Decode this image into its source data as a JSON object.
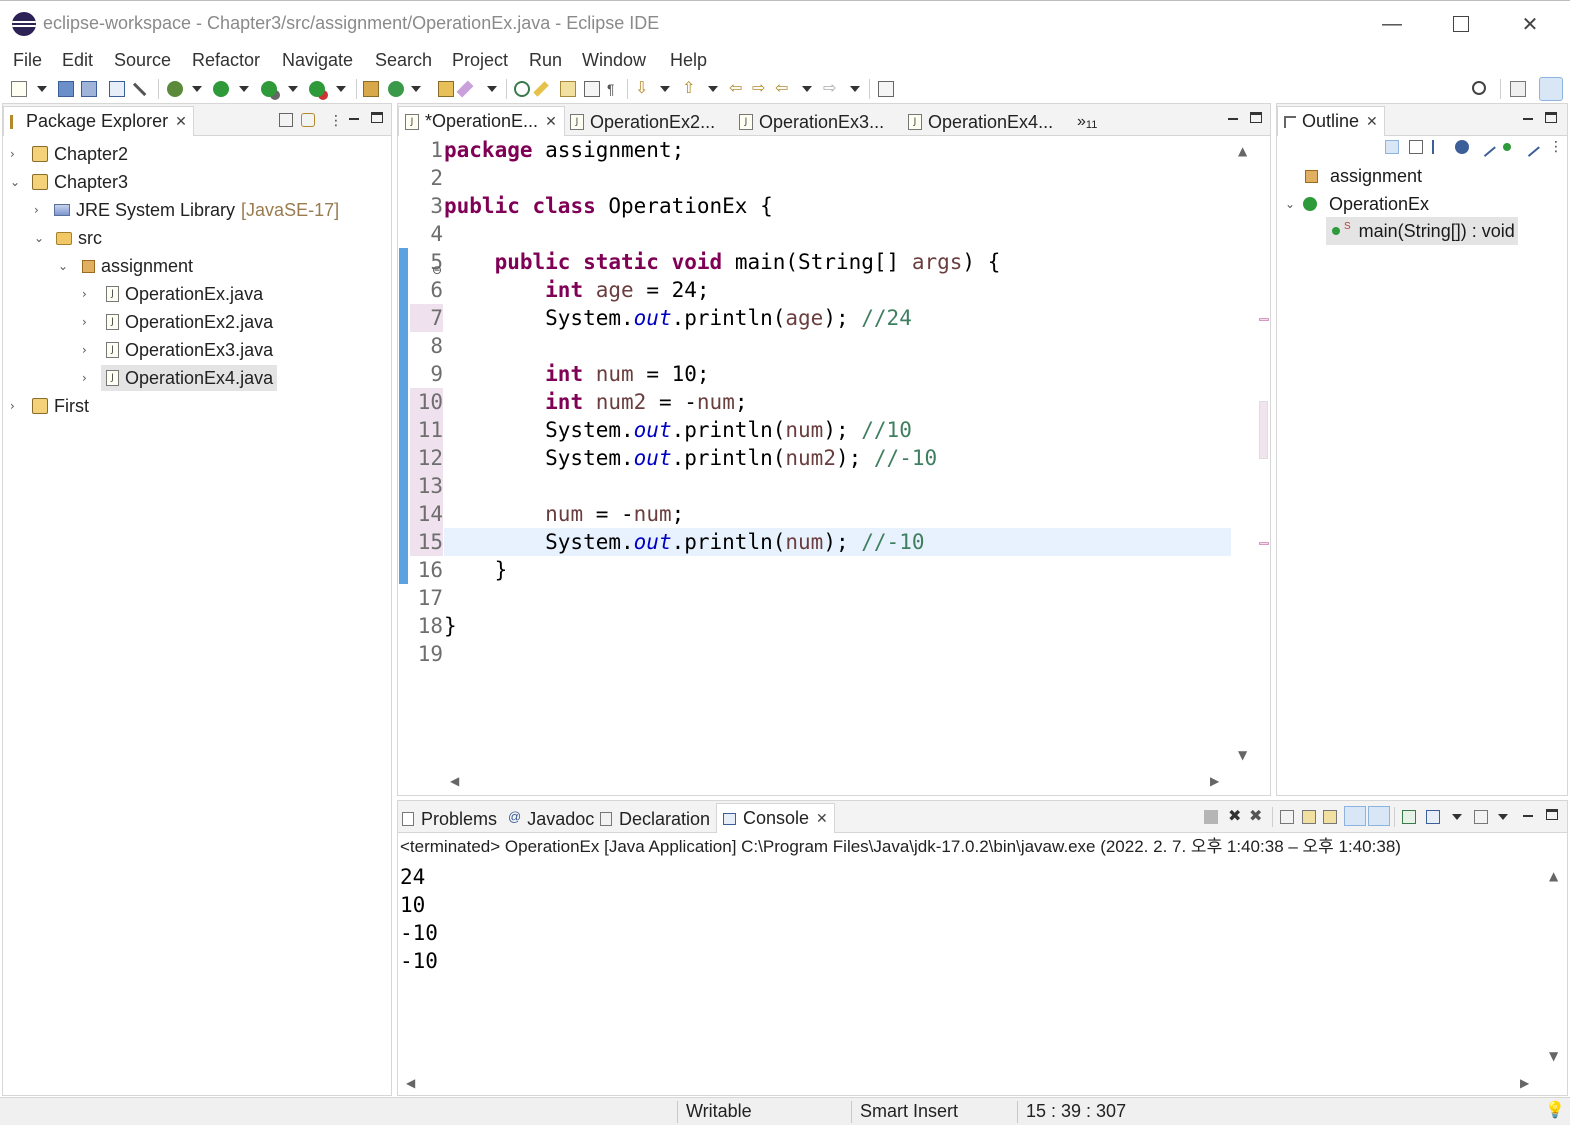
{
  "window": {
    "title": "eclipse-workspace - Chapter3/src/assignment/OperationEx.java - Eclipse IDE",
    "minimize": "—",
    "close": "✕"
  },
  "menubar": [
    "File",
    "Edit",
    "Source",
    "Refactor",
    "Navigate",
    "Search",
    "Project",
    "Run",
    "Window",
    "Help"
  ],
  "package_explorer": {
    "tab_label": "Package Explorer",
    "tree": [
      {
        "label": "Chapter2",
        "kind": "project",
        "expanded": false
      },
      {
        "label": "Chapter3",
        "kind": "project",
        "expanded": true
      },
      {
        "label": "JRE System Library",
        "decoration": "[JavaSE-17]",
        "kind": "library",
        "expanded": false
      },
      {
        "label": "src",
        "kind": "source-folder",
        "expanded": true
      },
      {
        "label": "assignment",
        "kind": "package",
        "expanded": true
      },
      {
        "label": "OperationEx.java",
        "kind": "java-file",
        "expanded": false
      },
      {
        "label": "OperationEx2.java",
        "kind": "java-file",
        "expanded": false
      },
      {
        "label": "OperationEx3.java",
        "kind": "java-file",
        "expanded": false
      },
      {
        "label": "OperationEx4.java",
        "kind": "java-file",
        "expanded": false,
        "selected": true
      },
      {
        "label": "First",
        "kind": "project",
        "expanded": false
      }
    ]
  },
  "editor": {
    "tabs": [
      {
        "label": "*OperationE...",
        "active": true
      },
      {
        "label": "OperationEx2..."
      },
      {
        "label": "OperationEx3..."
      },
      {
        "label": "OperationEx4..."
      }
    ],
    "overflow_label": "»",
    "overflow_count": "11",
    "current_line": 15,
    "changed_lines": [
      7,
      10,
      11,
      12,
      13,
      14,
      15
    ],
    "lines": [
      [
        {
          "t": "kw",
          "s": "package"
        },
        {
          "t": "",
          "s": " assignment;"
        }
      ],
      [],
      [
        {
          "t": "kw",
          "s": "public"
        },
        {
          "t": "",
          "s": " "
        },
        {
          "t": "kw",
          "s": "class"
        },
        {
          "t": "",
          "s": " OperationEx {"
        }
      ],
      [],
      [
        {
          "t": "",
          "s": "    "
        },
        {
          "t": "kw",
          "s": "public"
        },
        {
          "t": "",
          "s": " "
        },
        {
          "t": "kw",
          "s": "static"
        },
        {
          "t": "",
          "s": " "
        },
        {
          "t": "kw",
          "s": "void"
        },
        {
          "t": "",
          "s": " main(String[] "
        },
        {
          "t": "var",
          "s": "args"
        },
        {
          "t": "",
          "s": ") {"
        }
      ],
      [
        {
          "t": "",
          "s": "        "
        },
        {
          "t": "kw",
          "s": "int"
        },
        {
          "t": "",
          "s": " "
        },
        {
          "t": "var",
          "s": "age"
        },
        {
          "t": "",
          "s": " = 24;"
        }
      ],
      [
        {
          "t": "",
          "s": "        System."
        },
        {
          "t": "fld",
          "s": "out"
        },
        {
          "t": "",
          "s": ".println("
        },
        {
          "t": "var",
          "s": "age"
        },
        {
          "t": "",
          "s": "); "
        },
        {
          "t": "cmt",
          "s": "//24"
        }
      ],
      [],
      [
        {
          "t": "",
          "s": "        "
        },
        {
          "t": "kw",
          "s": "int"
        },
        {
          "t": "",
          "s": " "
        },
        {
          "t": "var",
          "s": "num"
        },
        {
          "t": "",
          "s": " = 10;"
        }
      ],
      [
        {
          "t": "",
          "s": "        "
        },
        {
          "t": "kw",
          "s": "int"
        },
        {
          "t": "",
          "s": " "
        },
        {
          "t": "var",
          "s": "num2"
        },
        {
          "t": "",
          "s": " = -"
        },
        {
          "t": "var",
          "s": "num"
        },
        {
          "t": "",
          "s": ";"
        }
      ],
      [
        {
          "t": "",
          "s": "        System."
        },
        {
          "t": "fld",
          "s": "out"
        },
        {
          "t": "",
          "s": ".println("
        },
        {
          "t": "var",
          "s": "num"
        },
        {
          "t": "",
          "s": "); "
        },
        {
          "t": "cmt",
          "s": "//10"
        }
      ],
      [
        {
          "t": "",
          "s": "        System."
        },
        {
          "t": "fld",
          "s": "out"
        },
        {
          "t": "",
          "s": ".println("
        },
        {
          "t": "var",
          "s": "num2"
        },
        {
          "t": "",
          "s": "); "
        },
        {
          "t": "cmt",
          "s": "//-10"
        }
      ],
      [],
      [
        {
          "t": "",
          "s": "        "
        },
        {
          "t": "var",
          "s": "num"
        },
        {
          "t": "",
          "s": " = -"
        },
        {
          "t": "var",
          "s": "num"
        },
        {
          "t": "",
          "s": ";"
        }
      ],
      [
        {
          "t": "",
          "s": "        System."
        },
        {
          "t": "fld",
          "s": "out"
        },
        {
          "t": "",
          "s": ".println("
        },
        {
          "t": "var",
          "s": "num"
        },
        {
          "t": "",
          "s": "); "
        },
        {
          "t": "cmt",
          "s": "//-10"
        }
      ],
      [
        {
          "t": "",
          "s": "    }"
        }
      ],
      [],
      [
        {
          "t": "",
          "s": "}"
        }
      ],
      []
    ]
  },
  "outline": {
    "tab_label": "Outline",
    "items": [
      {
        "label": "assignment",
        "kind": "package"
      },
      {
        "label": "OperationEx",
        "kind": "class",
        "expanded": true
      },
      {
        "label": "main(String[]) : void",
        "kind": "method",
        "selected": true
      }
    ]
  },
  "bottom_panel": {
    "tabs": [
      {
        "label": "Problems"
      },
      {
        "label": "Javadoc"
      },
      {
        "label": "Declaration"
      },
      {
        "label": "Console",
        "active": true
      }
    ],
    "console_header": "<terminated> OperationEx [Java Application] C:\\Program Files\\Java\\jdk-17.0.2\\bin\\javaw.exe  (2022. 2. 7. 오후 1:40:38 – 오후 1:40:38)",
    "output": [
      "24",
      "10",
      "-10",
      "-10"
    ]
  },
  "statusbar": {
    "mode": "Writable",
    "insert_mode": "Smart Insert",
    "position": "15 : 39 : 307"
  },
  "colors": {
    "keyword": "#7f0055",
    "static_field": "#0000c0",
    "local_variable": "#6a3e3e",
    "comment": "#3f7f5f",
    "current_line": "#e8f2fe",
    "change_ruler": "#5aa3e0"
  }
}
